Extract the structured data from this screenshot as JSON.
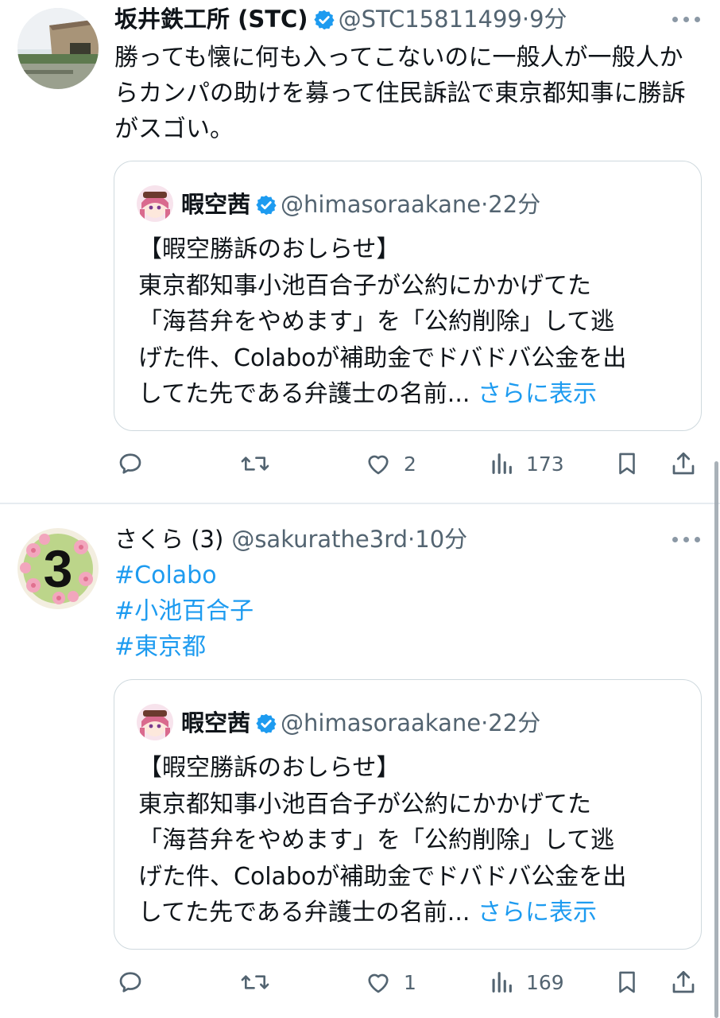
{
  "tweets": [
    {
      "author_name": "坂井鉄工所 (STC)",
      "handle": "@STC15811499",
      "separator": "·",
      "time": "9分",
      "text": "勝っても懐に何も入ってこないのに一般人が一般人からカンパの助けを募って住民訴訟で東京都知事に勝訴がスゴい。",
      "quote": {
        "author_name": "暇空茜",
        "handle": "@himasoraakane",
        "separator": "·",
        "time": "22分",
        "lines": [
          "【暇空勝訴のおしらせ】",
          "東京都知事小池百合子が公約にかかげてた",
          "「海苔弁をやめます」を「公約削除」して逃",
          "げた件、Colaboが補助金でドバドバ公金を出",
          "してた先である弁護士の名前... "
        ],
        "show_more": "さらに表示"
      },
      "actions": {
        "reply": "",
        "retweet": "",
        "like": "2",
        "views": "173"
      }
    },
    {
      "author_name": "さくら (3)",
      "handle": "@sakurathe3rd",
      "separator": "·",
      "time": "10分",
      "hashtags": [
        "#Colabo",
        "#小池百合子",
        "#東京都"
      ],
      "quote": {
        "author_name": "暇空茜",
        "handle": "@himasoraakane",
        "separator": "·",
        "time": "22分",
        "lines": [
          "【暇空勝訴のおしらせ】",
          "東京都知事小池百合子が公約にかかげてた",
          "「海苔弁をやめます」を「公約削除」して逃",
          "げた件、Colaboが補助金でドバドバ公金を出",
          "してた先である弁護士の名前... "
        ],
        "show_more": "さらに表示"
      },
      "actions": {
        "reply": "",
        "retweet": "",
        "like": "1",
        "views": "169"
      }
    }
  ],
  "colors": {
    "link": "#1d9bf0",
    "verified": "#1d9bf0",
    "muted": "#536471",
    "border": "#cfd9de"
  },
  "icons": [
    "reply-icon",
    "retweet-icon",
    "like-icon",
    "views-icon",
    "bookmark-icon",
    "share-icon",
    "verified-badge-icon",
    "more-options-icon"
  ]
}
